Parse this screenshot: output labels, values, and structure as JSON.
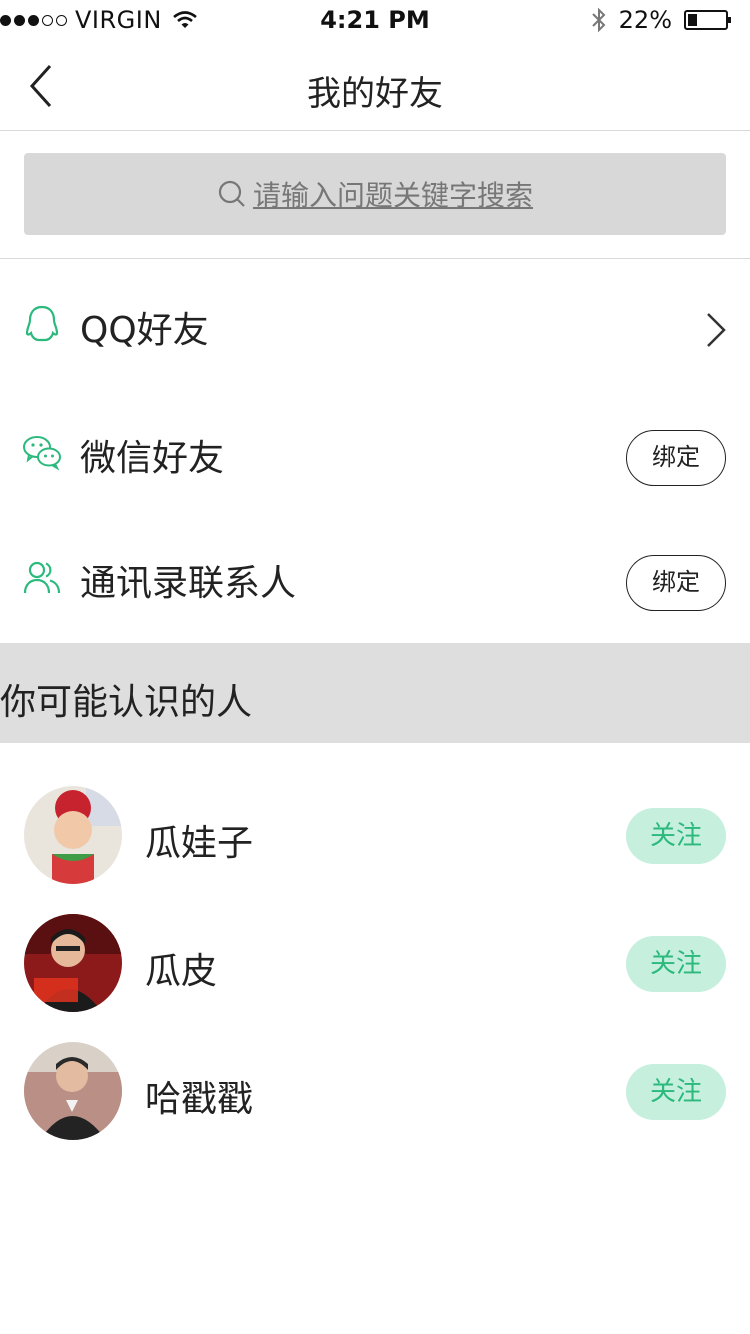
{
  "status_bar": {
    "carrier": "VIRGIN",
    "time": "4:21 PM",
    "battery": "22%",
    "signal_bars_filled": 3,
    "signal_bars_total": 5
  },
  "nav": {
    "title": "我的好友"
  },
  "search": {
    "placeholder": "请输入问题关键字搜索"
  },
  "friend_sources": [
    {
      "label": "QQ好友",
      "icon": "qq-icon",
      "action": "chevron"
    },
    {
      "label": "微信好友",
      "icon": "wechat-icon",
      "action_label": "绑定"
    },
    {
      "label": "通讯录联系人",
      "icon": "contacts-icon",
      "action_label": "绑定"
    }
  ],
  "suggestions": {
    "title": "你可能认识的人",
    "people": [
      {
        "name": "瓜娃子",
        "follow_label": "关注"
      },
      {
        "name": "瓜皮",
        "follow_label": "关注"
      },
      {
        "name": "哈戳戳",
        "follow_label": "关注"
      }
    ]
  },
  "colors": {
    "accent_green": "#2bb97d",
    "follow_bg": "#c6efdd",
    "section_bg": "#dedede",
    "search_bg": "#d8d8d8"
  }
}
